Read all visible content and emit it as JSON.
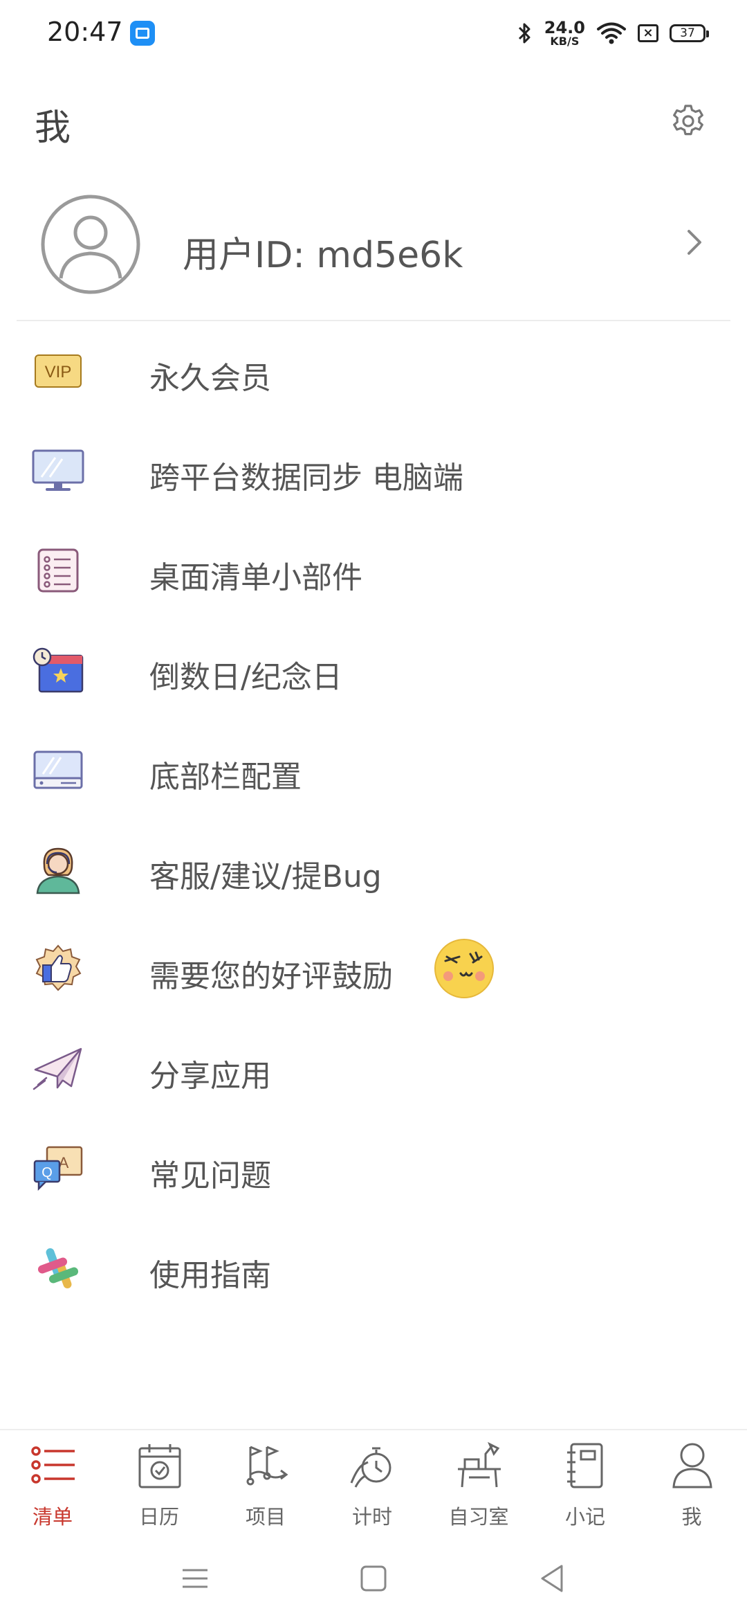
{
  "status_bar": {
    "time": "20:47",
    "net_speed_value": "24.0",
    "net_speed_unit": "KB/S",
    "battery": "37",
    "sim_status": "×",
    "icons": [
      "app-notification-icon",
      "bluetooth-icon",
      "wifi-icon",
      "sim-icon",
      "battery-icon"
    ]
  },
  "header": {
    "title": "我",
    "settings_icon": "gear-icon"
  },
  "profile": {
    "user_id": "用户ID: md5e6k",
    "avatar_icon": "user-avatar-icon",
    "chevron_icon": "chevron-right-icon"
  },
  "menu": [
    {
      "label": "永久会员",
      "icon": "vip-icon"
    },
    {
      "label": "跨平台数据同步 电脑端",
      "icon": "monitor-icon"
    },
    {
      "label": "桌面清单小部件",
      "icon": "checklist-icon"
    },
    {
      "label": "倒数日/纪念日",
      "icon": "calendar-star-icon"
    },
    {
      "label": "底部栏配置",
      "icon": "bottom-bar-icon"
    },
    {
      "label": "客服/建议/提Bug",
      "icon": "support-agent-icon"
    },
    {
      "label": "需要您的好评鼓励",
      "icon": "thumbs-up-badge-icon",
      "extra_icon": "wink-emoji-icon"
    },
    {
      "label": "分享应用",
      "icon": "paper-plane-icon"
    },
    {
      "label": "常见问题",
      "icon": "faq-icon"
    },
    {
      "label": "使用指南",
      "icon": "slack-guide-icon"
    }
  ],
  "tabs": [
    {
      "label": "清单",
      "icon": "list-icon",
      "active": true
    },
    {
      "label": "日历",
      "icon": "calendar-icon",
      "active": false
    },
    {
      "label": "项目",
      "icon": "project-flow-icon",
      "active": false
    },
    {
      "label": "计时",
      "icon": "stopwatch-icon",
      "active": false
    },
    {
      "label": "自习室",
      "icon": "desk-lamp-icon",
      "active": false
    },
    {
      "label": "小记",
      "icon": "notebook-icon",
      "active": false
    },
    {
      "label": "我",
      "icon": "person-icon",
      "active": false
    }
  ],
  "colors": {
    "accent": "#c8372d",
    "text": "#555555",
    "divider": "#ececec"
  },
  "system_nav": [
    "menu-icon",
    "home-icon",
    "back-icon"
  ]
}
